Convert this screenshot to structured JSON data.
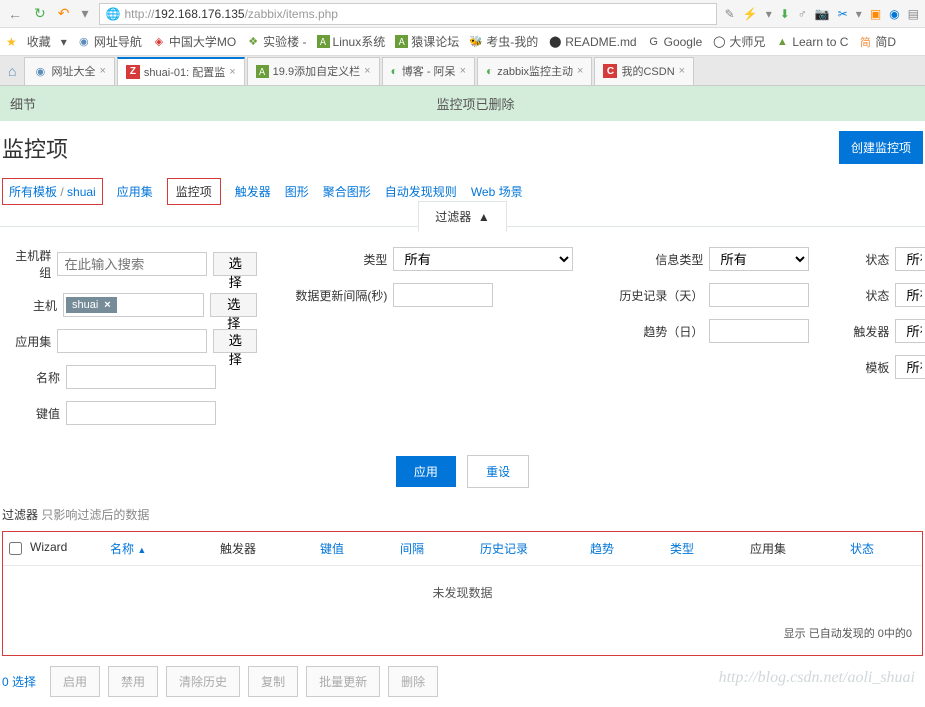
{
  "url": {
    "protocol": "http://",
    "host": "192.168.176.135",
    "path": "/zabbix/items.php"
  },
  "bookmarks": {
    "fav": "收藏",
    "items": [
      {
        "label": "网址导航"
      },
      {
        "label": "中国大学MO"
      },
      {
        "label": "实验楼 -"
      },
      {
        "label": "Linux系统"
      },
      {
        "label": "猿课论坛"
      },
      {
        "label": "考虫-我的"
      },
      {
        "label": "README.md"
      },
      {
        "label": "Google"
      },
      {
        "label": "大师兄"
      },
      {
        "label": "Learn to C"
      },
      {
        "label": "简D"
      }
    ]
  },
  "tabs": [
    {
      "label": "网址大全"
    },
    {
      "label": "shuai-01: 配置监"
    },
    {
      "label": "19.9添加自定义栏"
    },
    {
      "label": "博客 - 阿呆"
    },
    {
      "label": "zabbix监控主动"
    },
    {
      "label": "我的CSDN"
    }
  ],
  "banner": {
    "left": "细节",
    "center": "监控项已删除"
  },
  "header": {
    "title": "监控项",
    "create": "创建监控项"
  },
  "breadcrumb": {
    "all_templates": "所有模板",
    "host": "shuai"
  },
  "nav": {
    "apps": "应用集",
    "items": "监控项",
    "triggers": "触发器",
    "graphs": "图形",
    "screens": "聚合图形",
    "discovery": "自动发现规则",
    "web": "Web 场景"
  },
  "filter": {
    "toggle": "过滤器",
    "hostgroup": {
      "label": "主机群组",
      "placeholder": "在此输入搜索",
      "select": "选择"
    },
    "host": {
      "label": "主机",
      "tag": "shuai",
      "select": "选择"
    },
    "appset": {
      "label": "应用集",
      "select": "选择"
    },
    "name": {
      "label": "名称"
    },
    "key": {
      "label": "键值"
    },
    "type": {
      "label": "类型",
      "value": "所有"
    },
    "update_interval": {
      "label": "数据更新间隔(秒)"
    },
    "info_type": {
      "label": "信息类型",
      "value": "所有"
    },
    "history": {
      "label": "历史记录（天）"
    },
    "trend": {
      "label": "趋势（日）"
    },
    "state": {
      "label": "状态",
      "value": "所有"
    },
    "status": {
      "label": "状态",
      "value": "所有"
    },
    "triggers_lbl": {
      "label": "触发器",
      "value": "所有"
    },
    "template_lbl": {
      "label": "模板",
      "value": "所有"
    },
    "apply": "应用",
    "reset": "重设"
  },
  "filter_note": {
    "label": "过滤器",
    "text": "只影响过滤后的数据"
  },
  "table": {
    "cols": {
      "wizard": "Wizard",
      "name": "名称",
      "triggers": "触发器",
      "key": "键值",
      "interval": "间隔",
      "history": "历史记录",
      "trend": "趋势",
      "type": "类型",
      "apps": "应用集",
      "status": "状态"
    },
    "no_data": "未发现数据",
    "footer": "显示 已自动发现的 0中的0"
  },
  "bottom": {
    "selected": "0 选择",
    "enable": "启用",
    "disable": "禁用",
    "clear_history": "清除历史",
    "copy": "复制",
    "mass_update": "批量更新",
    "delete": "删除"
  },
  "watermark": "http://blog.csdn.net/aoli_shuai"
}
